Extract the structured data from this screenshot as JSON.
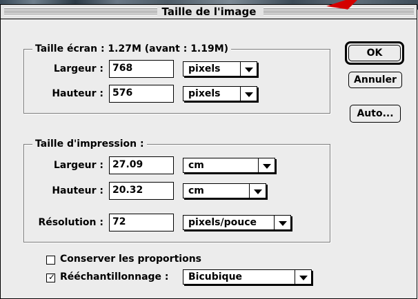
{
  "window": {
    "title": "Taille de l'image"
  },
  "screen_size": {
    "legend": "Taille écran : 1.27M (avant : 1.19M)",
    "width": {
      "label": "Largeur :",
      "value": "768",
      "unit": "pixels"
    },
    "height": {
      "label": "Hauteur :",
      "value": "576",
      "unit": "pixels"
    }
  },
  "print_size": {
    "legend": "Taille d'impression :",
    "width": {
      "label": "Largeur :",
      "value": "27.09",
      "unit": "cm"
    },
    "height": {
      "label": "Hauteur :",
      "value": "20.32",
      "unit": "cm"
    },
    "resolution": {
      "label": "Résolution :",
      "value": "72",
      "unit": "pixels/pouce"
    }
  },
  "options": {
    "constrain": {
      "label": "Conserver les proportions",
      "checked": false
    },
    "resample": {
      "label": "Rééchantillonnage :",
      "checked": true,
      "value": "Bicubique"
    }
  },
  "buttons": {
    "ok": "OK",
    "cancel": "Annuler",
    "auto": "Auto..."
  },
  "colors": {
    "dialog_bg": "#ececec",
    "accent_arrow": "#d40000"
  }
}
